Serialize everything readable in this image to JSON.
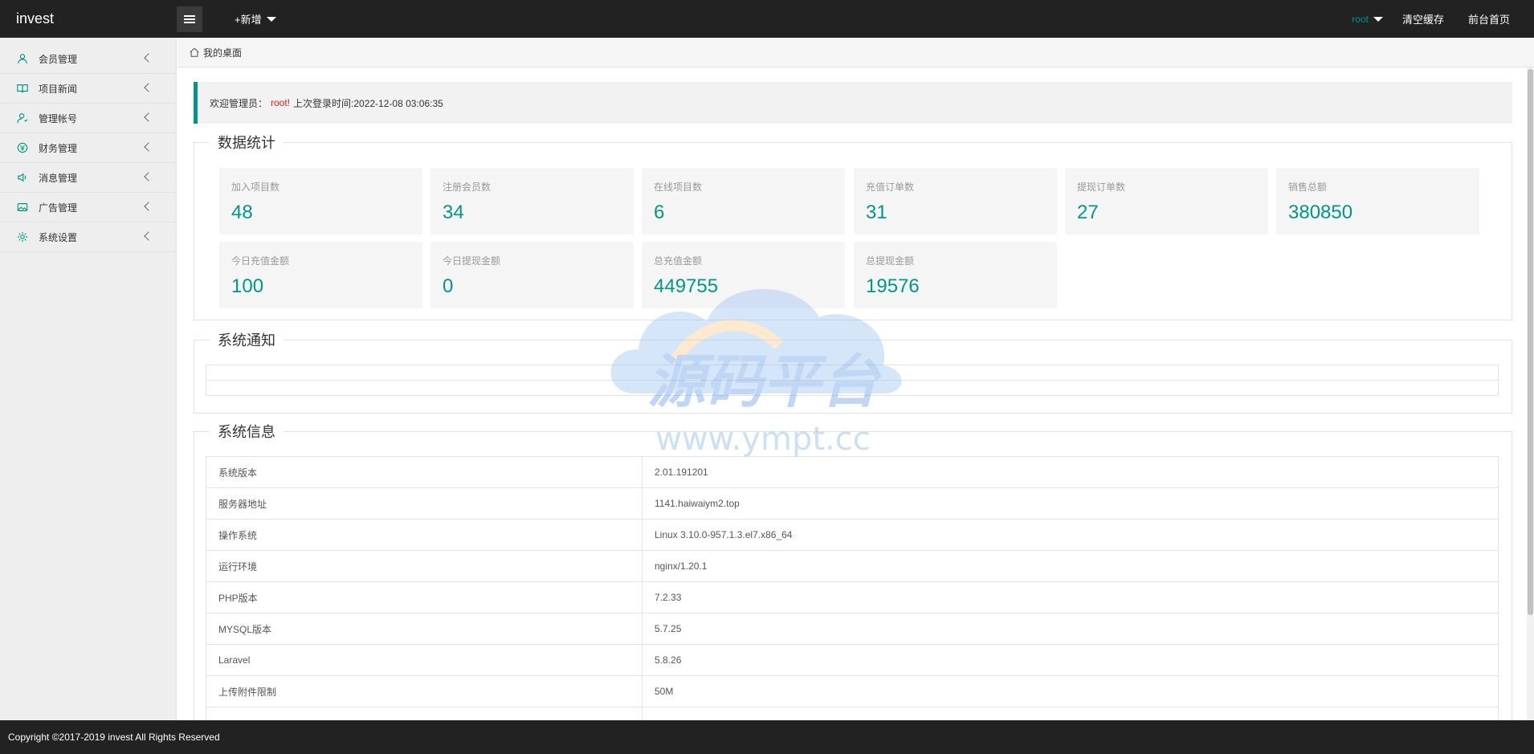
{
  "header": {
    "logo": "invest",
    "add_new": "+新增",
    "user": "root",
    "clear_cache": "清空缓存",
    "frontend_home": "前台首页"
  },
  "sidebar": {
    "items": [
      {
        "label": "会员管理",
        "icon": "user-icon"
      },
      {
        "label": "项目新闻",
        "icon": "book-icon"
      },
      {
        "label": "管理帐号",
        "icon": "admin-icon"
      },
      {
        "label": "财务管理",
        "icon": "finance-icon"
      },
      {
        "label": "消息管理",
        "icon": "speaker-icon"
      },
      {
        "label": "广告管理",
        "icon": "image-icon"
      },
      {
        "label": "系统设置",
        "icon": "gear-icon"
      }
    ]
  },
  "tabs": [
    {
      "label": "我的桌面",
      "icon": "home-icon"
    }
  ],
  "welcome": {
    "prefix": "欢迎管理员：",
    "user": "root!",
    "last_login": "上次登录时间:2022-12-08 03:06:35"
  },
  "stats": {
    "title": "数据统计",
    "items": [
      {
        "label": "加入项目数",
        "value": "48"
      },
      {
        "label": "注册会员数",
        "value": "34"
      },
      {
        "label": "在线项目数",
        "value": "6"
      },
      {
        "label": "充值订单数",
        "value": "31"
      },
      {
        "label": "提现订单数",
        "value": "27"
      },
      {
        "label": "销售总额",
        "value": "380850"
      },
      {
        "label": "今日充值金额",
        "value": "100"
      },
      {
        "label": "今日提现金额",
        "value": "0"
      },
      {
        "label": "总充值金额",
        "value": "449755"
      },
      {
        "label": "总提现金额",
        "value": "19576"
      }
    ]
  },
  "notice": {
    "title": "系统通知"
  },
  "sysinfo": {
    "title": "系统信息",
    "rows": [
      {
        "key": "系统版本",
        "value": "2.01.191201"
      },
      {
        "key": "服务器地址",
        "value": "1141.haiwaiym2.top"
      },
      {
        "key": "操作系统",
        "value": "Linux 3.10.0-957.1.3.el7.x86_64"
      },
      {
        "key": "运行环境",
        "value": "nginx/1.20.1"
      },
      {
        "key": "PHP版本",
        "value": "7.2.33"
      },
      {
        "key": "MYSQL版本",
        "value": "5.7.25"
      },
      {
        "key": "Laravel",
        "value": "5.8.26"
      },
      {
        "key": "上传附件限制",
        "value": "50M"
      }
    ]
  },
  "watermark": {
    "line1": "源码平台",
    "line2": "www.ympt.cc"
  },
  "footer": {
    "copyright": "Copyright ©2017-2019 invest All Rights Reserved"
  },
  "colors": {
    "accent": "#009688",
    "header_bg": "#222222",
    "welcome_user": "#e01e1e"
  }
}
